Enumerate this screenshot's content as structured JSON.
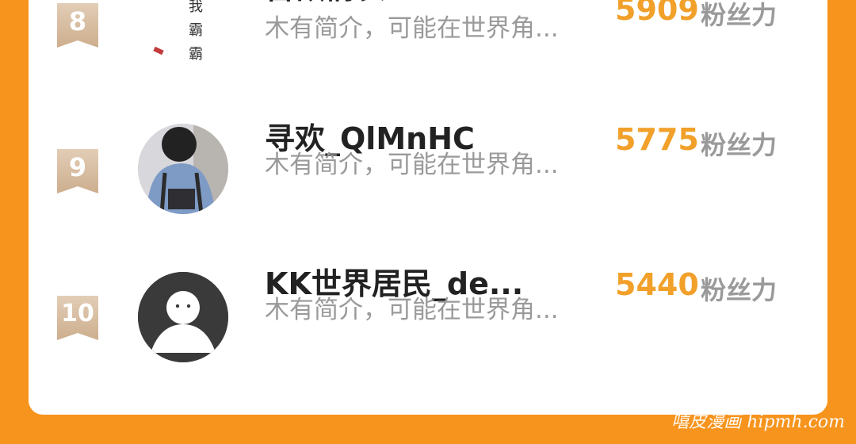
{
  "rankings": [
    {
      "rank": "8",
      "name": "吾欲情长",
      "desc": "木有简介，可能在世界角...",
      "score": "5909",
      "unit": "粉丝力"
    },
    {
      "rank": "9",
      "name": "寻欢_QlMnHC",
      "desc": "木有简介，可能在世界角...",
      "score": "5775",
      "unit": "粉丝力"
    },
    {
      "rank": "10",
      "name": "KK世界居民_de...",
      "desc": "木有简介，可能在世界角...",
      "score": "5440",
      "unit": "粉丝力"
    }
  ],
  "avatar_8": {
    "calligraphy": "我霸霸"
  },
  "watermark": "嘻皮漫画 hipmh.com",
  "colors": {
    "background": "#F7941D",
    "score": "#F1A02A",
    "rank_badge": "#D6BA9D"
  }
}
